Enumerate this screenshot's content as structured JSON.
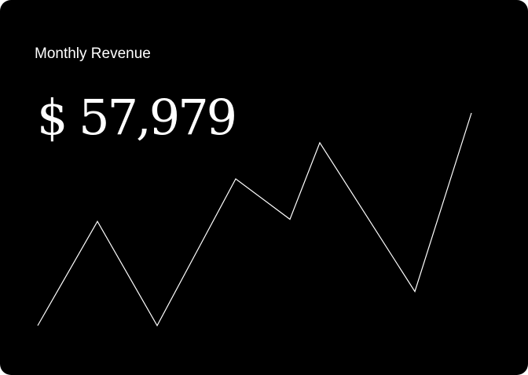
{
  "card": {
    "title": "Monthly Revenue",
    "value": "$ 57,979",
    "background_color": "#000000",
    "text_color": "#ffffff"
  },
  "chart_data": {
    "type": "line",
    "values": [
      0,
      49,
      0,
      69,
      50,
      86,
      16,
      100
    ],
    "line_color": "#ffffff",
    "grid": false,
    "axes": false
  }
}
